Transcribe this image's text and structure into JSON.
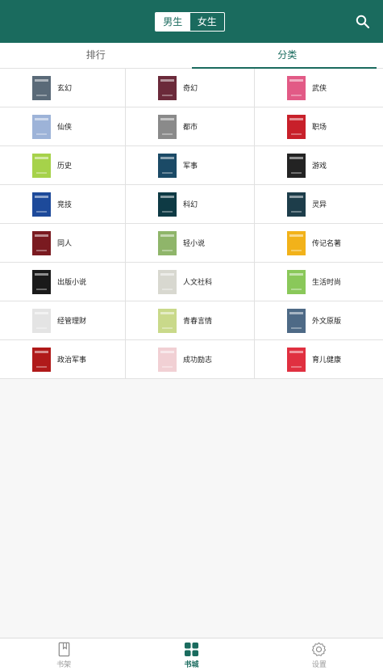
{
  "header": {
    "gender_options": [
      {
        "label": "男生",
        "active": true
      },
      {
        "label": "女生",
        "active": false
      }
    ],
    "search_icon": "search-icon",
    "bg_color": "#1a6b5e"
  },
  "tabs": [
    {
      "label": "排行",
      "active": false
    },
    {
      "label": "分类",
      "active": true
    }
  ],
  "categories": [
    {
      "label": "玄幻",
      "cover_color": "#5a6a78"
    },
    {
      "label": "奇幻",
      "cover_color": "#6b2a3a"
    },
    {
      "label": "武侠",
      "cover_color": "#e25a86"
    },
    {
      "label": "仙侠",
      "cover_color": "#9db3d8"
    },
    {
      "label": "都市",
      "cover_color": "#8a8a8a"
    },
    {
      "label": "职场",
      "cover_color": "#c8202a"
    },
    {
      "label": "历史",
      "cover_color": "#a6d24a"
    },
    {
      "label": "军事",
      "cover_color": "#1b4a66"
    },
    {
      "label": "游戏",
      "cover_color": "#232323"
    },
    {
      "label": "竞技",
      "cover_color": "#1d4a9a"
    },
    {
      "label": "科幻",
      "cover_color": "#0e3a44"
    },
    {
      "label": "灵异",
      "cover_color": "#1d3d4a"
    },
    {
      "label": "同人",
      "cover_color": "#7a1a20"
    },
    {
      "label": "轻小说",
      "cover_color": "#8fb56a"
    },
    {
      "label": "传记名著",
      "cover_color": "#f2b21a"
    },
    {
      "label": "出版小说",
      "cover_color": "#1a1a1a"
    },
    {
      "label": "人文社科",
      "cover_color": "#d8d8d0"
    },
    {
      "label": "生活时尚",
      "cover_color": "#8ac85a"
    },
    {
      "label": "经管理财",
      "cover_color": "#e4e4e4"
    },
    {
      "label": "青春言情",
      "cover_color": "#c9d98a"
    },
    {
      "label": "外文原版",
      "cover_color": "#4e6a86"
    },
    {
      "label": "政治军事",
      "cover_color": "#b01a1a"
    },
    {
      "label": "成功励志",
      "cover_color": "#f1d0d4"
    },
    {
      "label": "育儿健康",
      "cover_color": "#e03040"
    }
  ],
  "bottom_nav": [
    {
      "label": "书架",
      "icon": "book-icon",
      "active": false
    },
    {
      "label": "书城",
      "icon": "grid-icon",
      "active": true
    },
    {
      "label": "设置",
      "icon": "gear-icon",
      "active": false
    }
  ],
  "accent_color": "#1a6b5e"
}
